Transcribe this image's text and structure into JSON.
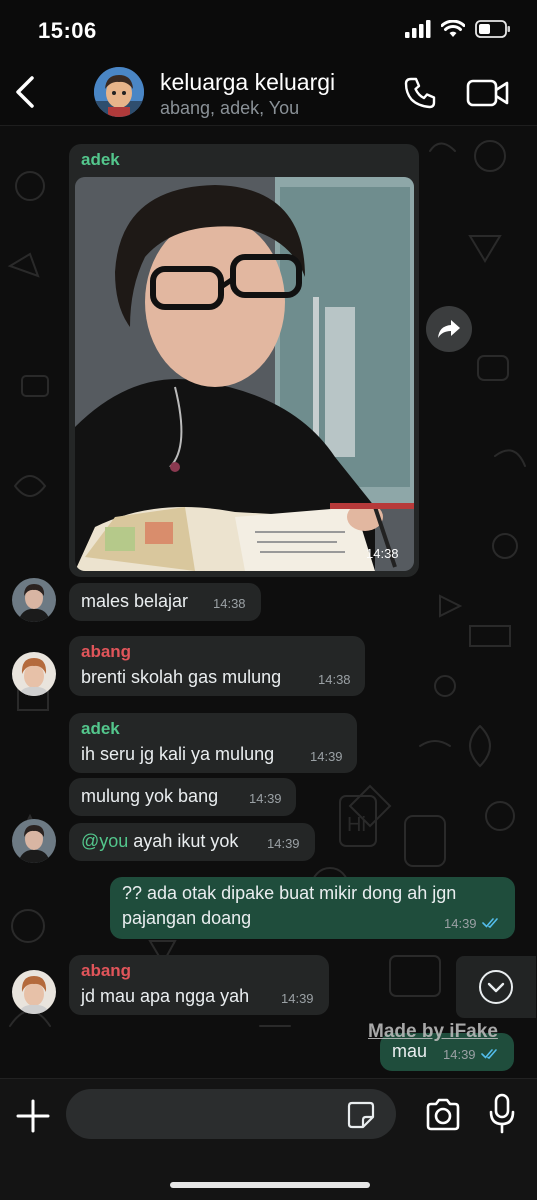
{
  "status_bar": {
    "time": "15:06"
  },
  "header": {
    "title": "keluarga keluargi",
    "members": "abang, adek, You"
  },
  "messages": {
    "m1": {
      "sender": "adek",
      "sender_color": "#53c68c",
      "time": "14:38",
      "type": "image"
    },
    "m2": {
      "text": "males belajar",
      "time": "14:38"
    },
    "m3": {
      "sender": "abang",
      "sender_color": "#e0555a",
      "text": "brenti skolah gas mulung",
      "time": "14:38"
    },
    "m4": {
      "sender": "adek",
      "sender_color": "#53c68c",
      "text": "ih seru jg kali ya mulung",
      "time": "14:39"
    },
    "m5": {
      "text": "mulung yok bang",
      "time": "14:39"
    },
    "m6": {
      "mention": "@you",
      "mention_color": "#53c68c",
      "text": " ayah ikut yok",
      "time": "14:39"
    },
    "m7": {
      "line1": "?? ada otak dipake buat mikir dong ah jgn",
      "line2": "pajangan doang",
      "time": "14:39",
      "read_status": "double-check-read-icon"
    },
    "m8": {
      "sender": "abang",
      "sender_color": "#e0555a",
      "text": "jd mau apa ngga yah",
      "time": "14:39"
    },
    "m9": {
      "text": "mau",
      "time": "14:39",
      "read_status": "double-check-read-icon"
    }
  },
  "watermark": "Made by iFake",
  "input": {
    "value": "",
    "placeholder": ""
  },
  "colors": {
    "incoming_bubble": "#242626",
    "outgoing_bubble": "#1f4d3c",
    "read_tick": "#53bdeb"
  }
}
